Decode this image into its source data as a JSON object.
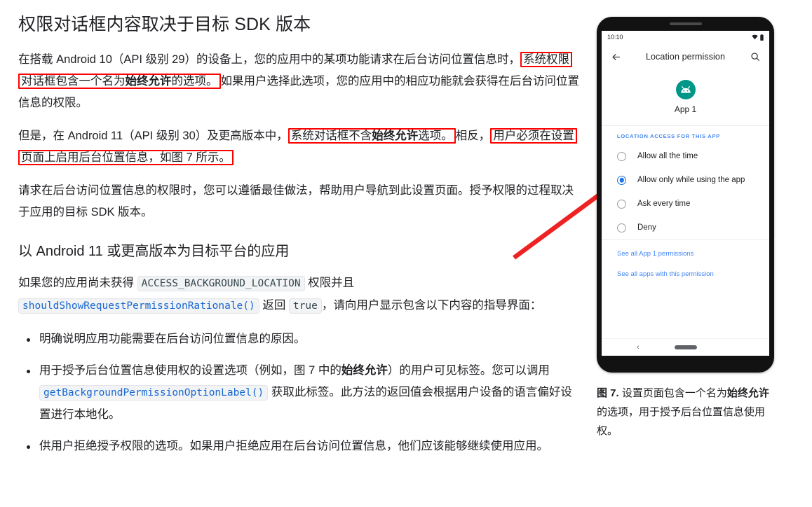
{
  "article": {
    "heading": "权限对话框内容取决于目标 SDK 版本",
    "para1": {
      "pre": "在搭载 Android 10（API 级别 29）的设备上，您的应用中的某项功能请求在后台访问位置信息时，",
      "highlight_pre": "系统权限对话框包含一个名为",
      "highlight_bold": "始终允许",
      "highlight_post": "的选项。",
      "post": "如果用户选择此选项，您的应用中的相应功能就会获得在后台访问位置信息的权限。"
    },
    "para2": {
      "pre": "但是，在 Android 11（API 级别 30）及更高版本中，",
      "highlight1_pre": "系统对话框不含",
      "highlight1_bold": "始终允许",
      "highlight1_post": "选项。",
      "mid": "相反，",
      "highlight2": "用户必须在设置页面上启用后台位置信息，如图 7 所示。"
    },
    "para3": "请求在后台访问位置信息的权限时，您可以遵循最佳做法，帮助用户导航到此设置页面。授予权限的过程取决于应用的目标 SDK 版本。",
    "subheading": "以 Android 11 或更高版本为目标平台的应用",
    "para4": {
      "pre": "如果您的应用尚未获得 ",
      "code1": "ACCESS_BACKGROUND_LOCATION",
      "mid1": " 权限并且 ",
      "code2": "shouldShowRequestPermissionRationale()",
      "mid2": " 返回 ",
      "code3": "true",
      "post": "，请向用户显示包含以下内容的指导界面："
    },
    "bullets": [
      {
        "text": "明确说明应用功能需要在后台访问位置信息的原因。"
      },
      {
        "pre": "用于授予后台位置信息使用权的设置选项（例如，图 7 中的",
        "bold": "始终允许",
        "mid": "）的用户可见标签。您可以调用 ",
        "code": "getBackgroundPermissionOptionLabel()",
        "post": " 获取此标签。此方法的返回值会根据用户设备的语言偏好设置进行本地化。"
      },
      {
        "text": "供用户拒绝授予权限的选项。如果用户拒绝应用在后台访问位置信息，他们应该能够继续使用应用。"
      }
    ]
  },
  "phone": {
    "status": {
      "time": "10:10",
      "wifi_icon": "wifi-icon",
      "battery_icon": "battery-icon"
    },
    "appbar": {
      "back_icon": "back-arrow-icon",
      "title": "Location permission",
      "search_icon": "search-icon"
    },
    "app": {
      "icon": "android-app-icon",
      "name": "App 1",
      "icon_color": "#009688"
    },
    "section_label": "LOCATION ACCESS FOR THIS APP",
    "options": [
      {
        "label": "Allow all the time",
        "selected": false
      },
      {
        "label": "Allow only while using the app",
        "selected": true
      },
      {
        "label": "Ask every time",
        "selected": false
      },
      {
        "label": "Deny",
        "selected": false
      }
    ],
    "links": [
      "See all App 1 permissions",
      "See all apps with this permission"
    ],
    "navbar": {
      "back_icon": "nav-back-icon",
      "home_pill": "home-pill-indicator"
    },
    "accent_color": "#1a73e8",
    "link_color": "#4285f4"
  },
  "caption": {
    "figure_label": "图 7.",
    "pre": " 设置页面包含一个名为",
    "bold": "始终允许",
    "post": "的选项，用于授予后台位置信息使用权。"
  },
  "annotation": {
    "color": "#ff0000",
    "arrow_name": "red-pointer-arrow"
  }
}
